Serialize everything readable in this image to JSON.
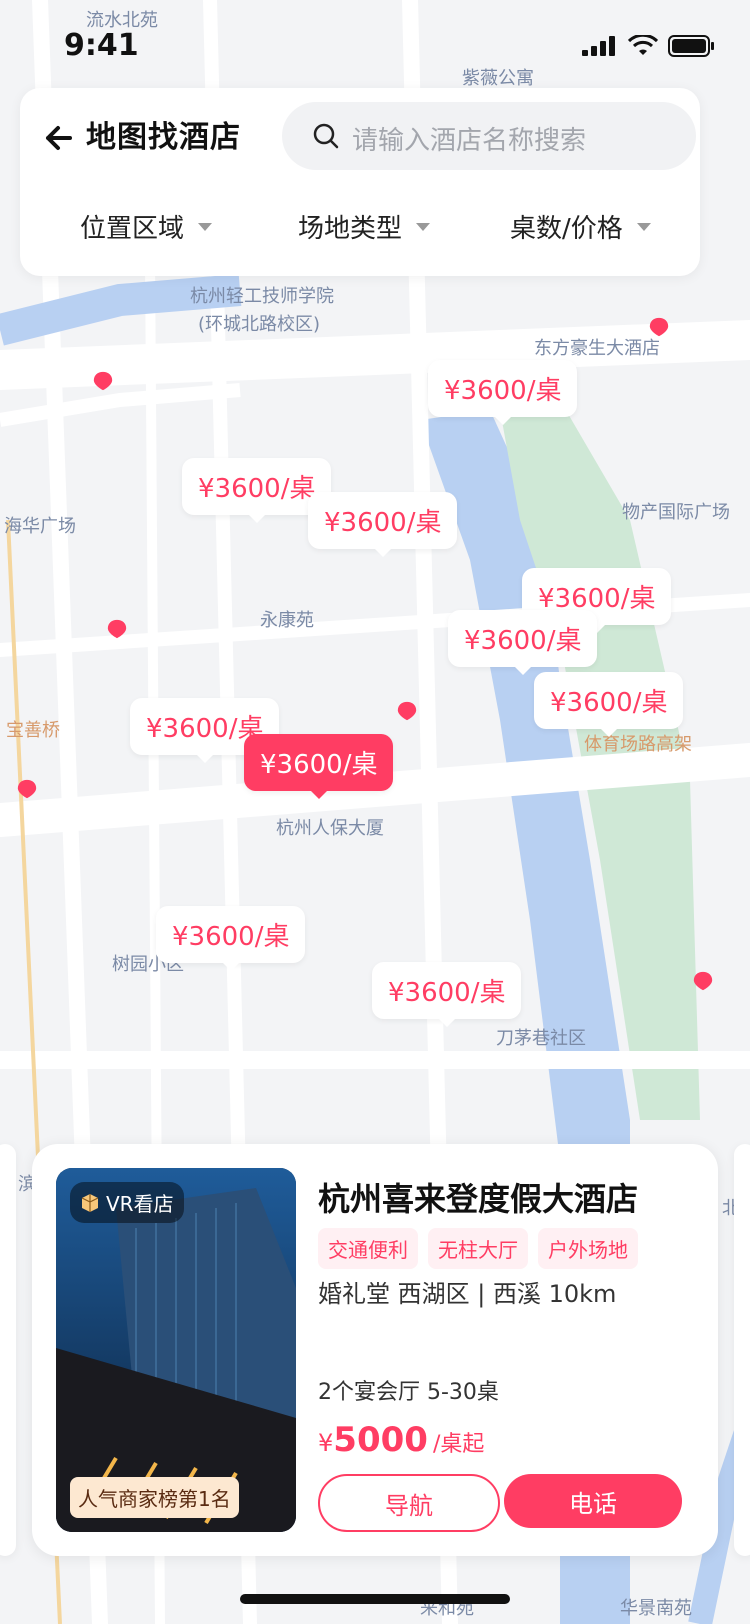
{
  "status": {
    "time": "9:41"
  },
  "header": {
    "title": "地图找酒店",
    "search_placeholder": "请输入酒店名称搜索",
    "filters": [
      "位置区域",
      "场地类型",
      "桌数/价格"
    ]
  },
  "map": {
    "labels": [
      "流水北苑",
      "紫薇公寓",
      "杭州轻工技师学院",
      "(环城北路校区)",
      "东方豪生大酒店",
      "海华广场",
      "物产国际广场",
      "永康苑",
      "宝善桥",
      "体育场路高架",
      "杭州人保大厦",
      "树园小区",
      "刀茅巷社区",
      "滨",
      "北",
      "华景南苑",
      "来和苑"
    ],
    "price_tags": [
      "¥3600/桌",
      "¥3600/桌",
      "¥3600/桌",
      "¥3600/桌",
      "¥3600/桌",
      "¥3600/桌",
      "¥3600/桌",
      "¥3600/桌",
      "¥3600/桌",
      "¥3600/桌"
    ],
    "accent": "#ff3d63",
    "water": "#b8d0f2",
    "green": "#cfe8d6"
  },
  "card": {
    "vr_label": "VR看店",
    "rank_label": "人气商家榜第1名",
    "name": "杭州喜来登度假大酒店",
    "badges": [
      "交通便利",
      "无柱大厅",
      "户外场地"
    ],
    "meta": "婚礼堂  西湖区 | 西溪 10km",
    "halls": "2个宴会厅  5-30桌",
    "price_symbol": "¥",
    "price_value": "5000",
    "price_unit": "/桌起",
    "nav_button": "导航",
    "call_button": "电话"
  }
}
